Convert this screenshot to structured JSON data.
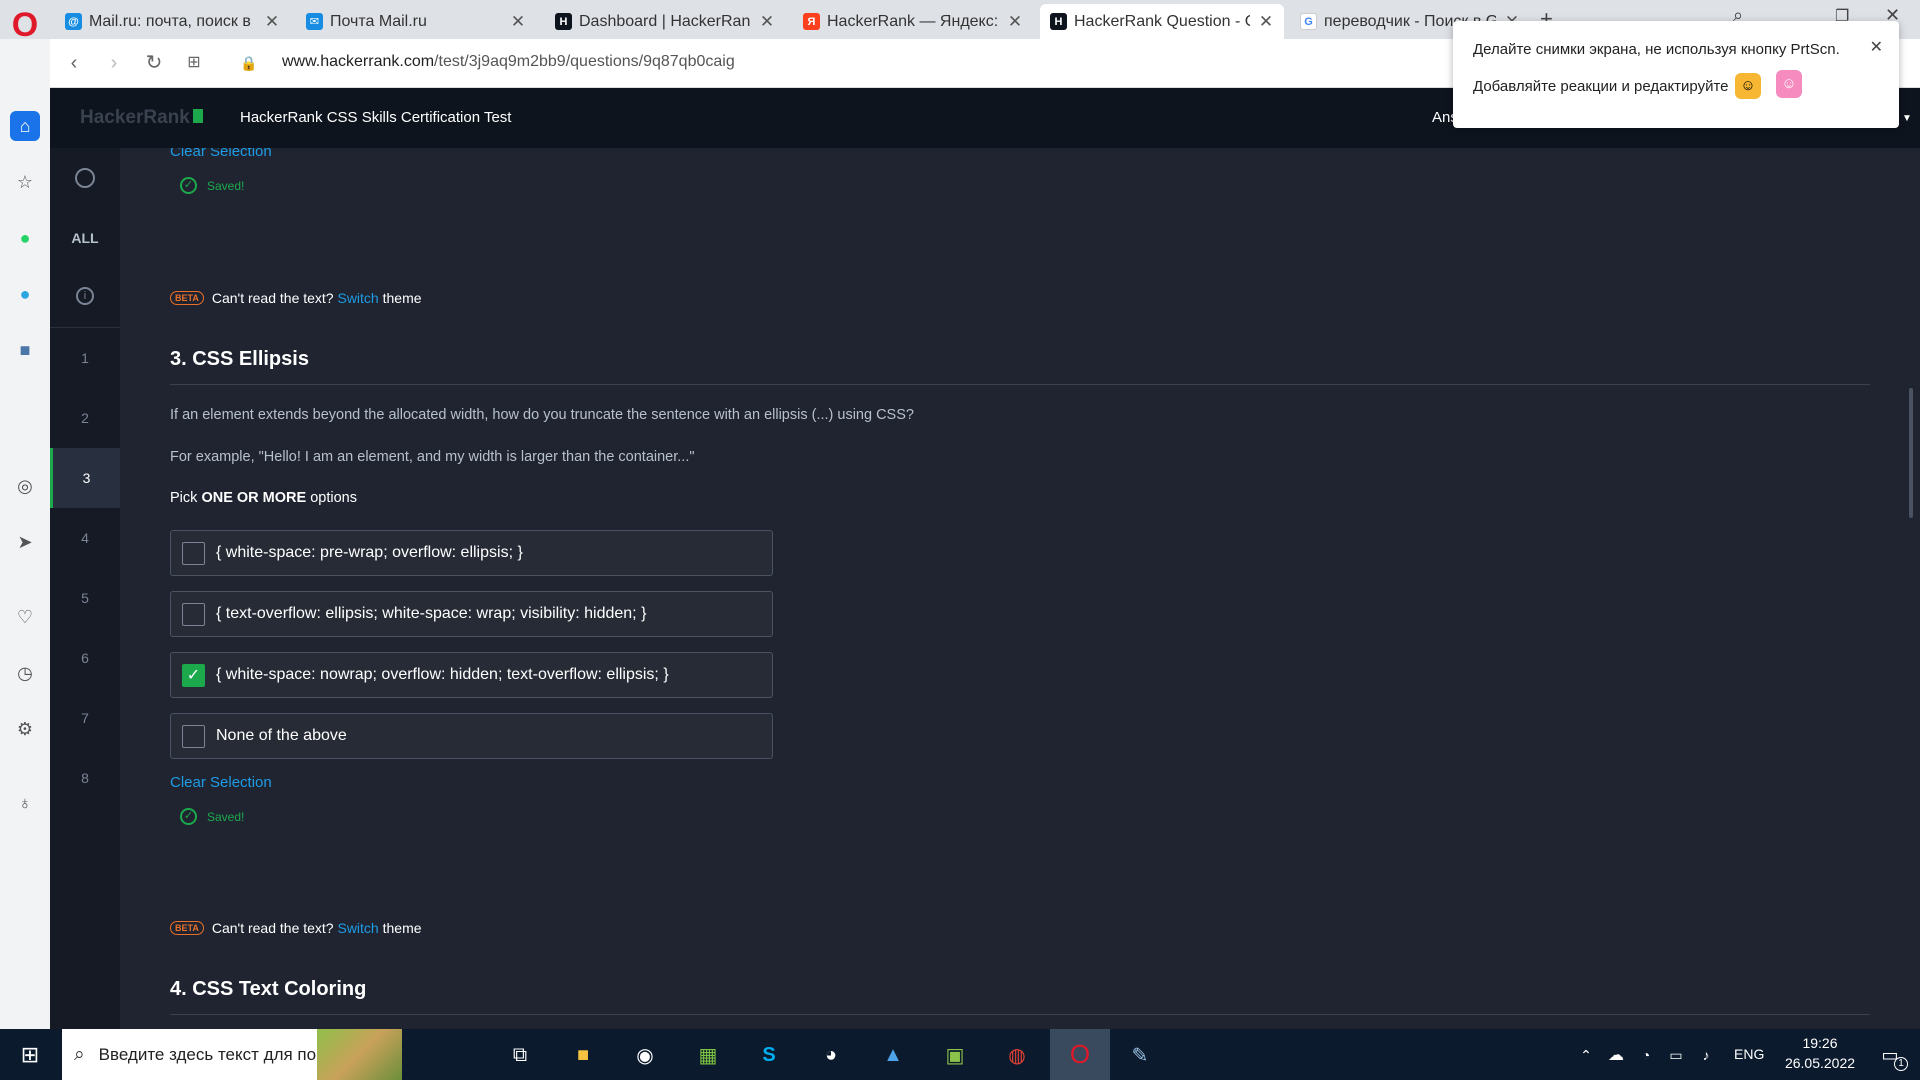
{
  "tabs": [
    {
      "title": "Mail.ru: почта, поиск в интернете",
      "icon": "mailru-icon"
    },
    {
      "title": "Почта Mail.ru",
      "icon": "mail-icon"
    },
    {
      "title": "Dashboard | HackerRank",
      "icon": "hackerrank-icon"
    },
    {
      "title": "HackerRank — Яндекс: нашлось",
      "icon": "yandex-icon"
    },
    {
      "title": "HackerRank Question - CSS",
      "icon": "hackerrank-icon"
    },
    {
      "title": "переводчик - Поиск в Google",
      "icon": "google-icon"
    }
  ],
  "url": {
    "domain": "www.hackerrank.com",
    "path": "/test/3j9aq9m2bb9/questions/9q87qb0caig"
  },
  "toast": {
    "line1": "Делайте снимки экрана, не используя кнопку PrtScn.",
    "line2": "Добавляйте реакции и редактируйте"
  },
  "header": {
    "logo": "HackerRank",
    "title": "HackerRank CSS Skills Certification Test",
    "answered": "Ans"
  },
  "qnav": {
    "all_label": "ALL",
    "numbers": [
      "1",
      "2",
      "3",
      "4",
      "5",
      "6",
      "7",
      "8"
    ],
    "current": "3"
  },
  "prev": {
    "clear": "Clear Selection",
    "saved": "Saved!"
  },
  "beta": {
    "badge": "BETA",
    "pre": "Can't read the text?",
    "link": "Switch",
    "post": "theme"
  },
  "q3": {
    "title": "3. CSS Ellipsis",
    "p1": "If an element extends beyond the allocated width, how do you truncate the sentence with an ellipsis (...) using CSS?",
    "p2": "For example, \"Hello! I am an element, and my width is larger than the container...\"",
    "pick_pre": "Pick",
    "pick_bold": "ONE OR MORE",
    "pick_post": "options",
    "options": [
      {
        "text": "{ white-space: pre-wrap; overflow: ellipsis; }",
        "checked": false
      },
      {
        "text": "{ text-overflow: ellipsis; white-space: wrap; visibility: hidden; }",
        "checked": false
      },
      {
        "text": "{ white-space: nowrap; overflow: hidden; text-overflow: ellipsis; }",
        "checked": true
      },
      {
        "text": "None of the above",
        "checked": false
      }
    ],
    "clear": "Clear Selection",
    "saved": "Saved!"
  },
  "q4": {
    "title": "4. CSS Text Coloring"
  },
  "taskbar": {
    "search_placeholder": "Введите здесь текст для поиска",
    "lang": "ENG",
    "time": "19:26",
    "date": "26.05.2022",
    "notif_count": "1"
  }
}
